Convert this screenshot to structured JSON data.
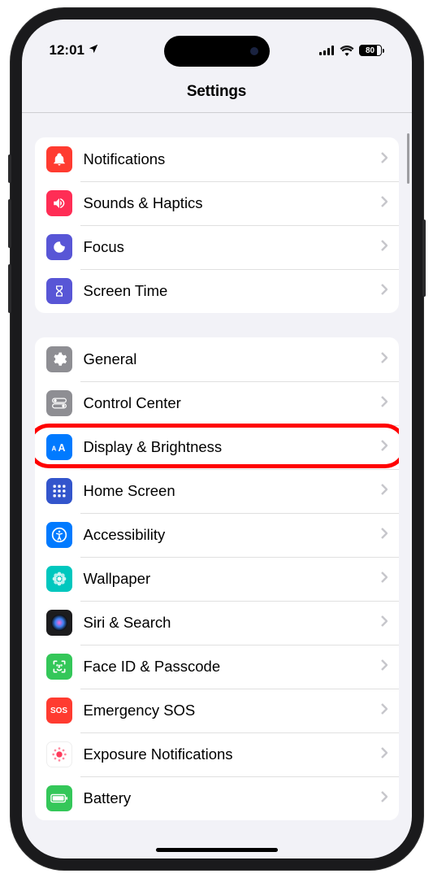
{
  "status": {
    "time": "12:01",
    "battery_pct": "80"
  },
  "header": {
    "title": "Settings"
  },
  "sections": [
    {
      "items": [
        {
          "key": "notifications",
          "label": "Notifications"
        },
        {
          "key": "sounds",
          "label": "Sounds & Haptics"
        },
        {
          "key": "focus",
          "label": "Focus"
        },
        {
          "key": "screentime",
          "label": "Screen Time"
        }
      ]
    },
    {
      "items": [
        {
          "key": "general",
          "label": "General"
        },
        {
          "key": "controlcenter",
          "label": "Control Center"
        },
        {
          "key": "display",
          "label": "Display & Brightness",
          "highlighted": true
        },
        {
          "key": "homescreen",
          "label": "Home Screen"
        },
        {
          "key": "accessibility",
          "label": "Accessibility"
        },
        {
          "key": "wallpaper",
          "label": "Wallpaper"
        },
        {
          "key": "siri",
          "label": "Siri & Search"
        },
        {
          "key": "faceid",
          "label": "Face ID & Passcode"
        },
        {
          "key": "sos",
          "label": "Emergency SOS"
        },
        {
          "key": "exposure",
          "label": "Exposure Notifications"
        },
        {
          "key": "battery",
          "label": "Battery"
        }
      ]
    }
  ]
}
